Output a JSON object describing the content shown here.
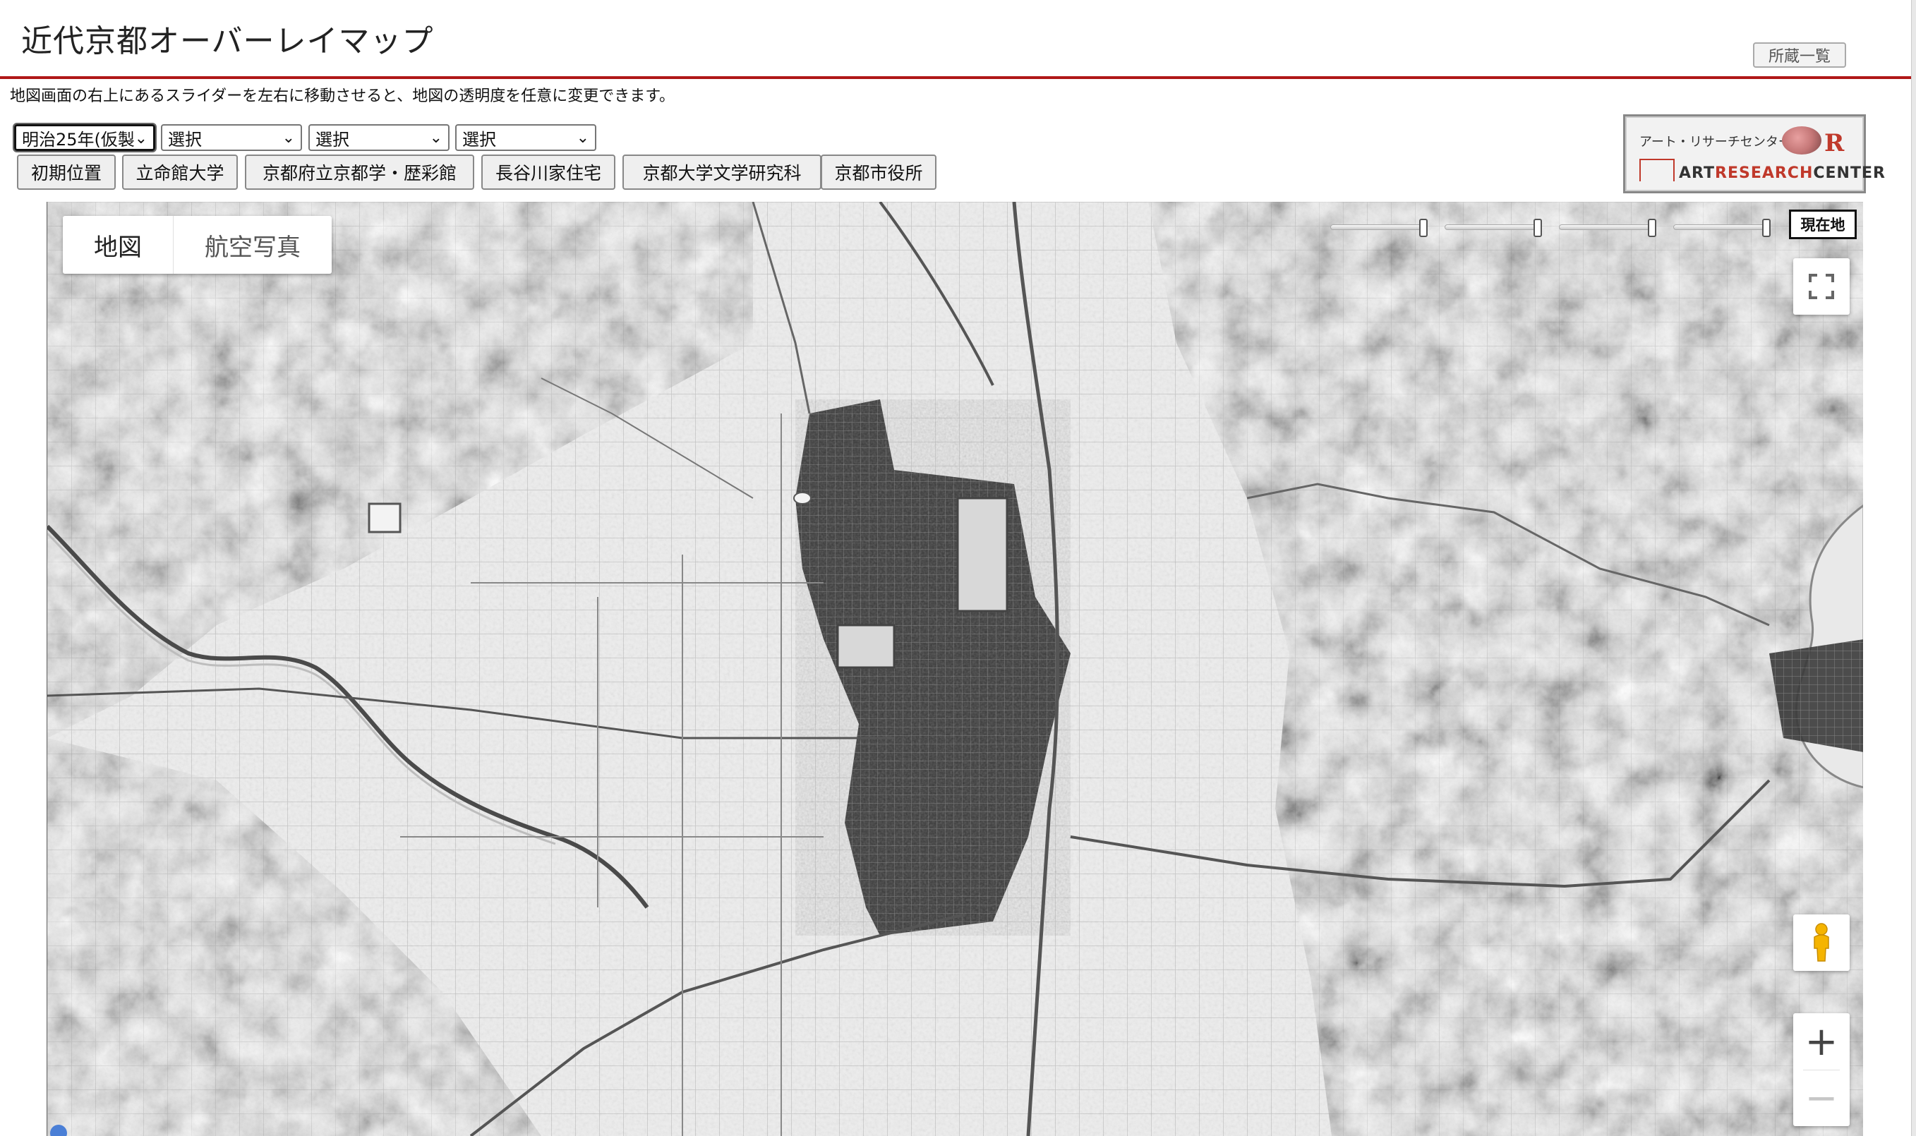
{
  "header": {
    "title": "近代京都オーバーレイマップ",
    "collection_button": "所蔵一覧"
  },
  "instruction": "地図画面の右上にあるスライダーを左右に移動させると、地図の透明度を任意に変更できます。",
  "selects": [
    {
      "value": "明治25年(仮製"
    },
    {
      "value": "選択"
    },
    {
      "value": "選択"
    },
    {
      "value": "選択"
    }
  ],
  "location_buttons": [
    "初期位置",
    "立命館大学",
    "京都府立京都学・歴彩館",
    "長谷川家住宅",
    "京都大学文学研究科",
    "京都市役所"
  ],
  "logo": {
    "jp": "アート・リサーチセンター",
    "en_art": "ART",
    "en_research": "RESEARCH",
    "en_center": "CENTER",
    "mark": "R"
  },
  "map": {
    "type_buttons": [
      "地図",
      "航空写真"
    ],
    "active_type": "地図",
    "opacity_sliders": [
      1.0,
      1.0,
      1.0,
      1.0
    ],
    "current_location_label": "現在地",
    "zoom_in": "+",
    "zoom_out": "−",
    "icons": [
      "fullscreen-icon",
      "pegman-icon",
      "chevron-down-icon"
    ]
  },
  "colors": {
    "header_rule": "#b01818",
    "logo_accent": "#c0392b",
    "pegman": "#f5b400"
  }
}
